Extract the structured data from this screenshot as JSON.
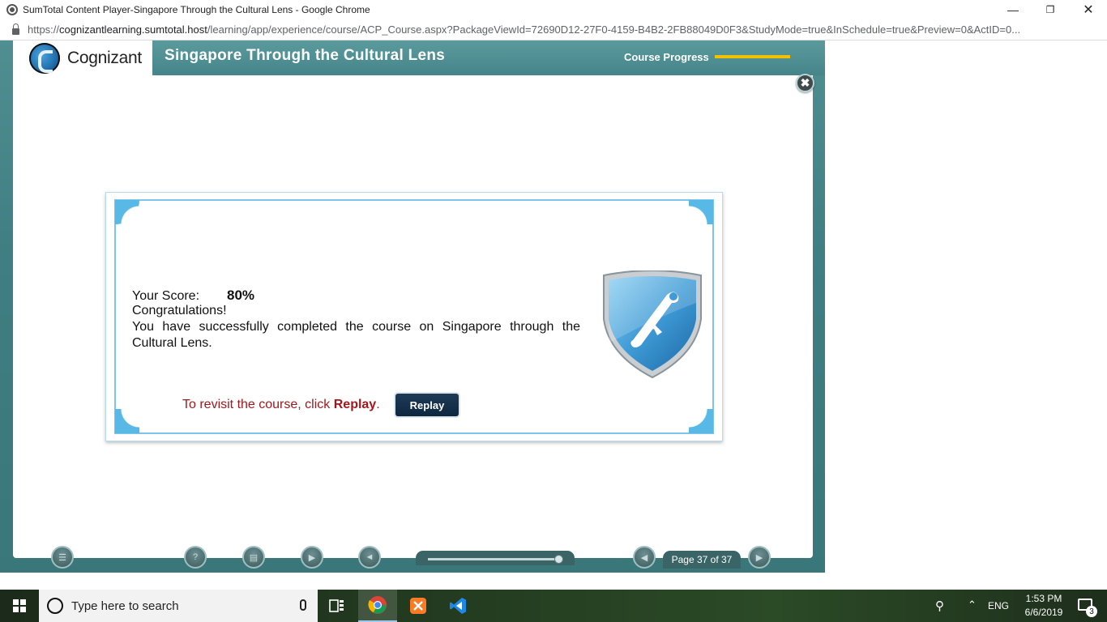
{
  "window": {
    "title": "SumTotal Content Player-Singapore Through the Cultural Lens - Google Chrome",
    "minimize_icon": "minimize-icon",
    "maximize_icon": "restore-icon",
    "close_icon": "close-icon"
  },
  "address_bar": {
    "scheme": "https://",
    "host": "cognizantlearning.sumtotal.host",
    "path": "/learning/app/experience/course/ACP_Course.aspx?PackageViewId=72690D12-27F0-4159-B4B2-2FB88049D0F3&StudyMode=true&InSchedule=true&Preview=0&ActID=0..."
  },
  "player": {
    "logo_text": "Cognizant",
    "course_title": "Singapore Through the Cultural Lens",
    "progress_label": "Course Progress",
    "progress_fraction": 1.0,
    "accent_color": "#f2c200",
    "close_symbol": "✖"
  },
  "result_card": {
    "score_label": "Your Score:",
    "score_value": "80%",
    "congrats": "Congratulations!",
    "message": "You have successfully completed the course on Singapore through the Cultural Lens.",
    "replay_prefix": "To revisit the course, click ",
    "replay_bold": "Replay",
    "replay_suffix": ".",
    "replay_button": "Replay",
    "badge_icon": "diploma-shield-icon"
  },
  "nav": {
    "page_indicator": "Page 37 of 37",
    "slider_fraction": 1.0,
    "buttons": [
      "menu-icon",
      "help-icon",
      "glossary-icon",
      "play-icon",
      "audio-icon",
      "previous-icon",
      "next-icon"
    ]
  },
  "taskbar": {
    "search_placeholder": "Type here to search",
    "apps": [
      "task-view-icon",
      "chrome-icon",
      "xampp-icon",
      "vscode-icon"
    ],
    "lang": "ENG",
    "time": "1:53 PM",
    "date": "6/6/2019",
    "notification_count": "3"
  }
}
